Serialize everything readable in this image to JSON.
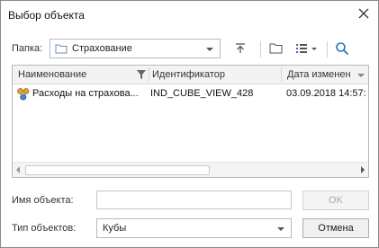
{
  "window": {
    "title": "Выбор объекта"
  },
  "folder": {
    "label": "Папка:",
    "value": "Страхование"
  },
  "toolbar": {
    "up_icon": "folder-up-icon",
    "new_folder_icon": "new-folder-icon",
    "view_icon": "list-view-icon",
    "search_icon": "search-icon"
  },
  "list": {
    "columns": [
      "Наименование",
      "Идентификатор",
      "Дата изменен"
    ],
    "rows": [
      {
        "name": "Расходы на страхова...",
        "id": "IND_CUBE_VIEW_428",
        "date": "03.09.2018 14:57:"
      }
    ]
  },
  "object_name": {
    "label": "Имя объекта:",
    "value": ""
  },
  "object_type": {
    "label": "Тип объектов:",
    "value": "Кубы"
  },
  "buttons": {
    "ok": "OK",
    "cancel": "Отмена"
  },
  "colors": {
    "folder_icon": "#6a8fb5",
    "cube_icon": "#e0a030",
    "search_icon": "#2f6fb8"
  }
}
